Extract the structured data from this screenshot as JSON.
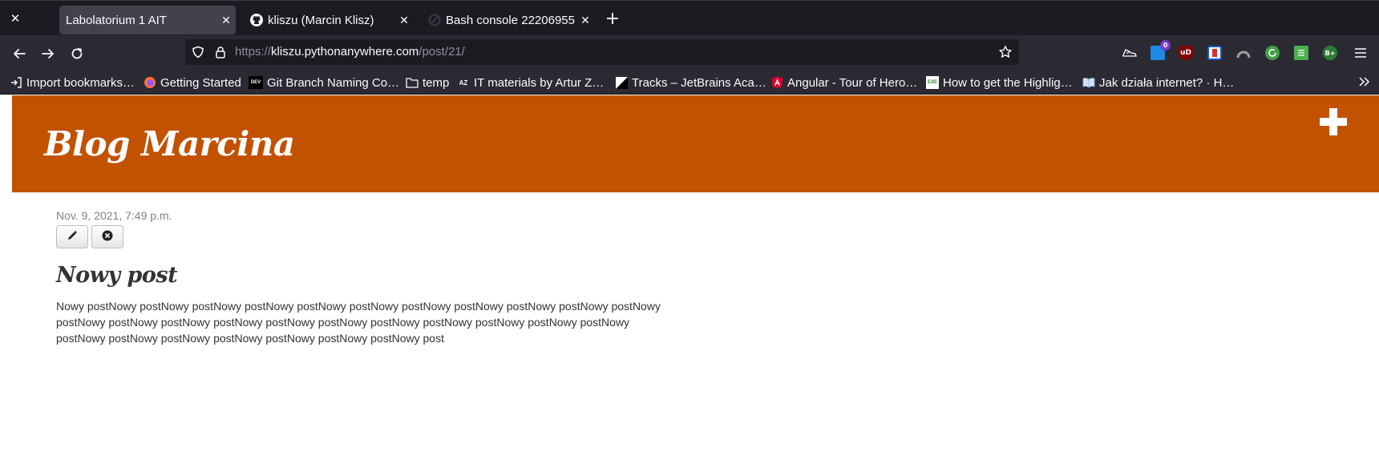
{
  "browser": {
    "tabs": [
      {
        "title": "Labolatorium 1 AIT",
        "active": true,
        "icon": "none"
      },
      {
        "title": "kliszu (Marcin Klisz)",
        "active": false,
        "icon": "github-icon"
      },
      {
        "title": "Bash console 22206955 : ",
        "active": false,
        "icon": "pythonanywhere-icon"
      }
    ],
    "url": {
      "scheme": "https://",
      "domain": "kliszu.pythonanywhere.com",
      "path": "/post/21/"
    },
    "extensions": [
      {
        "name": "shoe-extension-icon",
        "color": "#fbfbfe"
      },
      {
        "name": "tab-counter-extension-icon",
        "color": "#1e88e5",
        "badge": "0"
      },
      {
        "name": "ublock-origin-icon",
        "color": "#800000",
        "label": "uD"
      },
      {
        "name": "bitwarden-icon",
        "color": "#1a57d6"
      },
      {
        "name": "arc-extension-icon",
        "color": "#9e9e9e"
      },
      {
        "name": "refresh-extension-icon",
        "color": "#43a047"
      },
      {
        "name": "sheet-extension-icon",
        "color": "#4caf50"
      },
      {
        "name": "b-plus-extension-icon",
        "color": "#2e7d32",
        "label": "B+"
      }
    ],
    "bookmarks": [
      {
        "label": "Import bookmarks…",
        "icon": "import-icon"
      },
      {
        "label": "Getting Started",
        "icon": "firefox-icon"
      },
      {
        "label": "Git Branch Naming Co…",
        "icon": "dev-icon",
        "icon_text": "DEV"
      },
      {
        "label": "temp",
        "icon": "folder-icon"
      },
      {
        "label": "IT materials by Artur Z…",
        "icon": "az-icon"
      },
      {
        "label": "Tracks – JetBrains Aca…",
        "icon": "jetbrains-icon"
      },
      {
        "label": "Angular - Tour of Hero…",
        "icon": "angular-icon"
      },
      {
        "label": "How to get the Highlig…",
        "icon": "exe-icon",
        "icon_text": "EXE"
      },
      {
        "label": "Jak działa internet? · H…",
        "icon": "book-icon"
      }
    ]
  },
  "page": {
    "site_title": "Blog Marcina",
    "post": {
      "date": "Nov. 9, 2021, 7:49 p.m.",
      "title": "Nowy post",
      "body": "Nowy postNowy postNowy postNowy postNowy postNowy postNowy postNowy postNowy postNowy postNowy postNowy postNowy postNowy postNowy postNowy postNowy postNowy postNowy postNowy postNowy postNowy postNowy postNowy postNowy postNowy postNowy postNowy postNowy postNowy post"
    }
  },
  "colors": {
    "header_bg": "#c25100",
    "toolbar_bg": "#2b2a33",
    "tabbar_bg": "#1c1b22"
  }
}
